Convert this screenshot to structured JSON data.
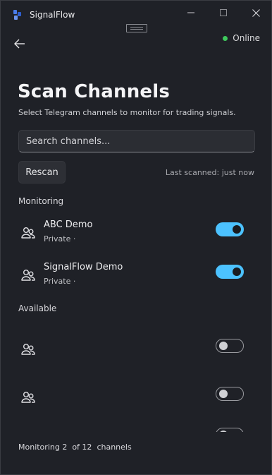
{
  "app": {
    "title": "SignalFlow"
  },
  "status": {
    "label": "Online",
    "color": "#3ec95c"
  },
  "page": {
    "title": "Scan Channels",
    "subtitle": "Select Telegram channels to monitor for trading signals."
  },
  "search": {
    "placeholder": "Search channels...",
    "value": ""
  },
  "toolbar": {
    "rescan_label": "Rescan",
    "last_scanned": "Last scanned: just now"
  },
  "sections": {
    "monitoring_label": "Monitoring",
    "available_label": "Available"
  },
  "monitoring": [
    {
      "name": "ABC Demo",
      "meta": "Private ·",
      "enabled": true,
      "icon": "group-icon"
    },
    {
      "name": "SignalFlow Demo",
      "meta": "Private ·",
      "enabled": true,
      "icon": "group-icon"
    }
  ],
  "available": [
    {
      "name": "",
      "meta": "",
      "enabled": false,
      "icon": "group-icon"
    },
    {
      "name": "",
      "meta": "",
      "enabled": false,
      "icon": "group-icon"
    },
    {
      "name": "",
      "meta": "",
      "enabled": false,
      "icon": "group-icon"
    }
  ],
  "footer": {
    "prefix": "Monitoring",
    "count": "2",
    "of_text": "of 12",
    "suffix": "channels"
  },
  "colors": {
    "accent": "#4cc2ff",
    "background": "#1f2127"
  }
}
